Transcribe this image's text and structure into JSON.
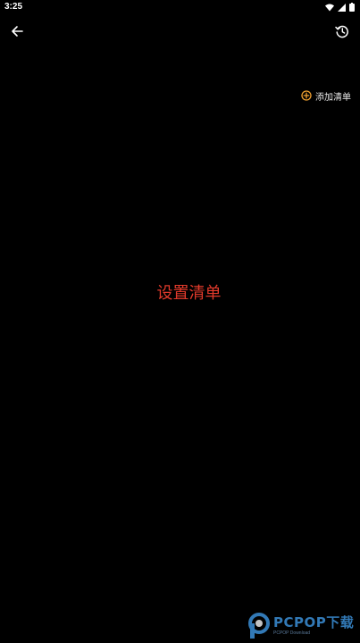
{
  "status_bar": {
    "time": "3:25",
    "icons": [
      "wifi-icon",
      "cellular-signal-icon",
      "battery-icon"
    ]
  },
  "header": {
    "back_icon": "arrow-left-icon",
    "history_icon": "history-icon"
  },
  "actions": {
    "add_list_label": "添加清单",
    "add_list_icon": "plus-circle-icon"
  },
  "main": {
    "title": "设置清单"
  },
  "watermark": {
    "brand": "PCPOP下载",
    "sub": "PCPOP Download"
  },
  "colors": {
    "background": "#000000",
    "accent_orange": "#f0a030",
    "title_red": "#e23a2b",
    "watermark_blue": "#3b8fd6"
  }
}
